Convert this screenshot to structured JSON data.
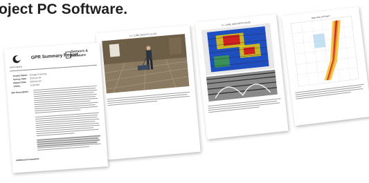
{
  "headline": "oject PC Software.",
  "report": {
    "company": "SunCompany",
    "title": "GPR Summary Report",
    "brand_line1": "Sensors &",
    "brand_line2": "Software",
    "fields": [
      {
        "key": "Project Name:",
        "value": "Garage Scanning"
      },
      {
        "key": "Survey Date:",
        "value": "2019-01-04"
      },
      {
        "key": "Report Date:",
        "value": "2019-01-04"
      },
      {
        "key": "Client:",
        "value": "Customer"
      }
    ],
    "observations_label": "Site Description:",
    "additional_label": "Additional Comments:"
  },
  "photo_page": {
    "caption": "C:\\...\\LINE_0001.DT1 (1 of 3)"
  },
  "radar_page": {
    "caption": "C:\\...\\LINE_0000 DEPTH SLICE"
  },
  "plot_page": {
    "caption": "Map View of Project"
  },
  "colors": {
    "radar_red": "#d02020",
    "radar_yellow": "#f0d000",
    "radar_blue": "#2050c0",
    "band_orange": "#e8842c"
  }
}
